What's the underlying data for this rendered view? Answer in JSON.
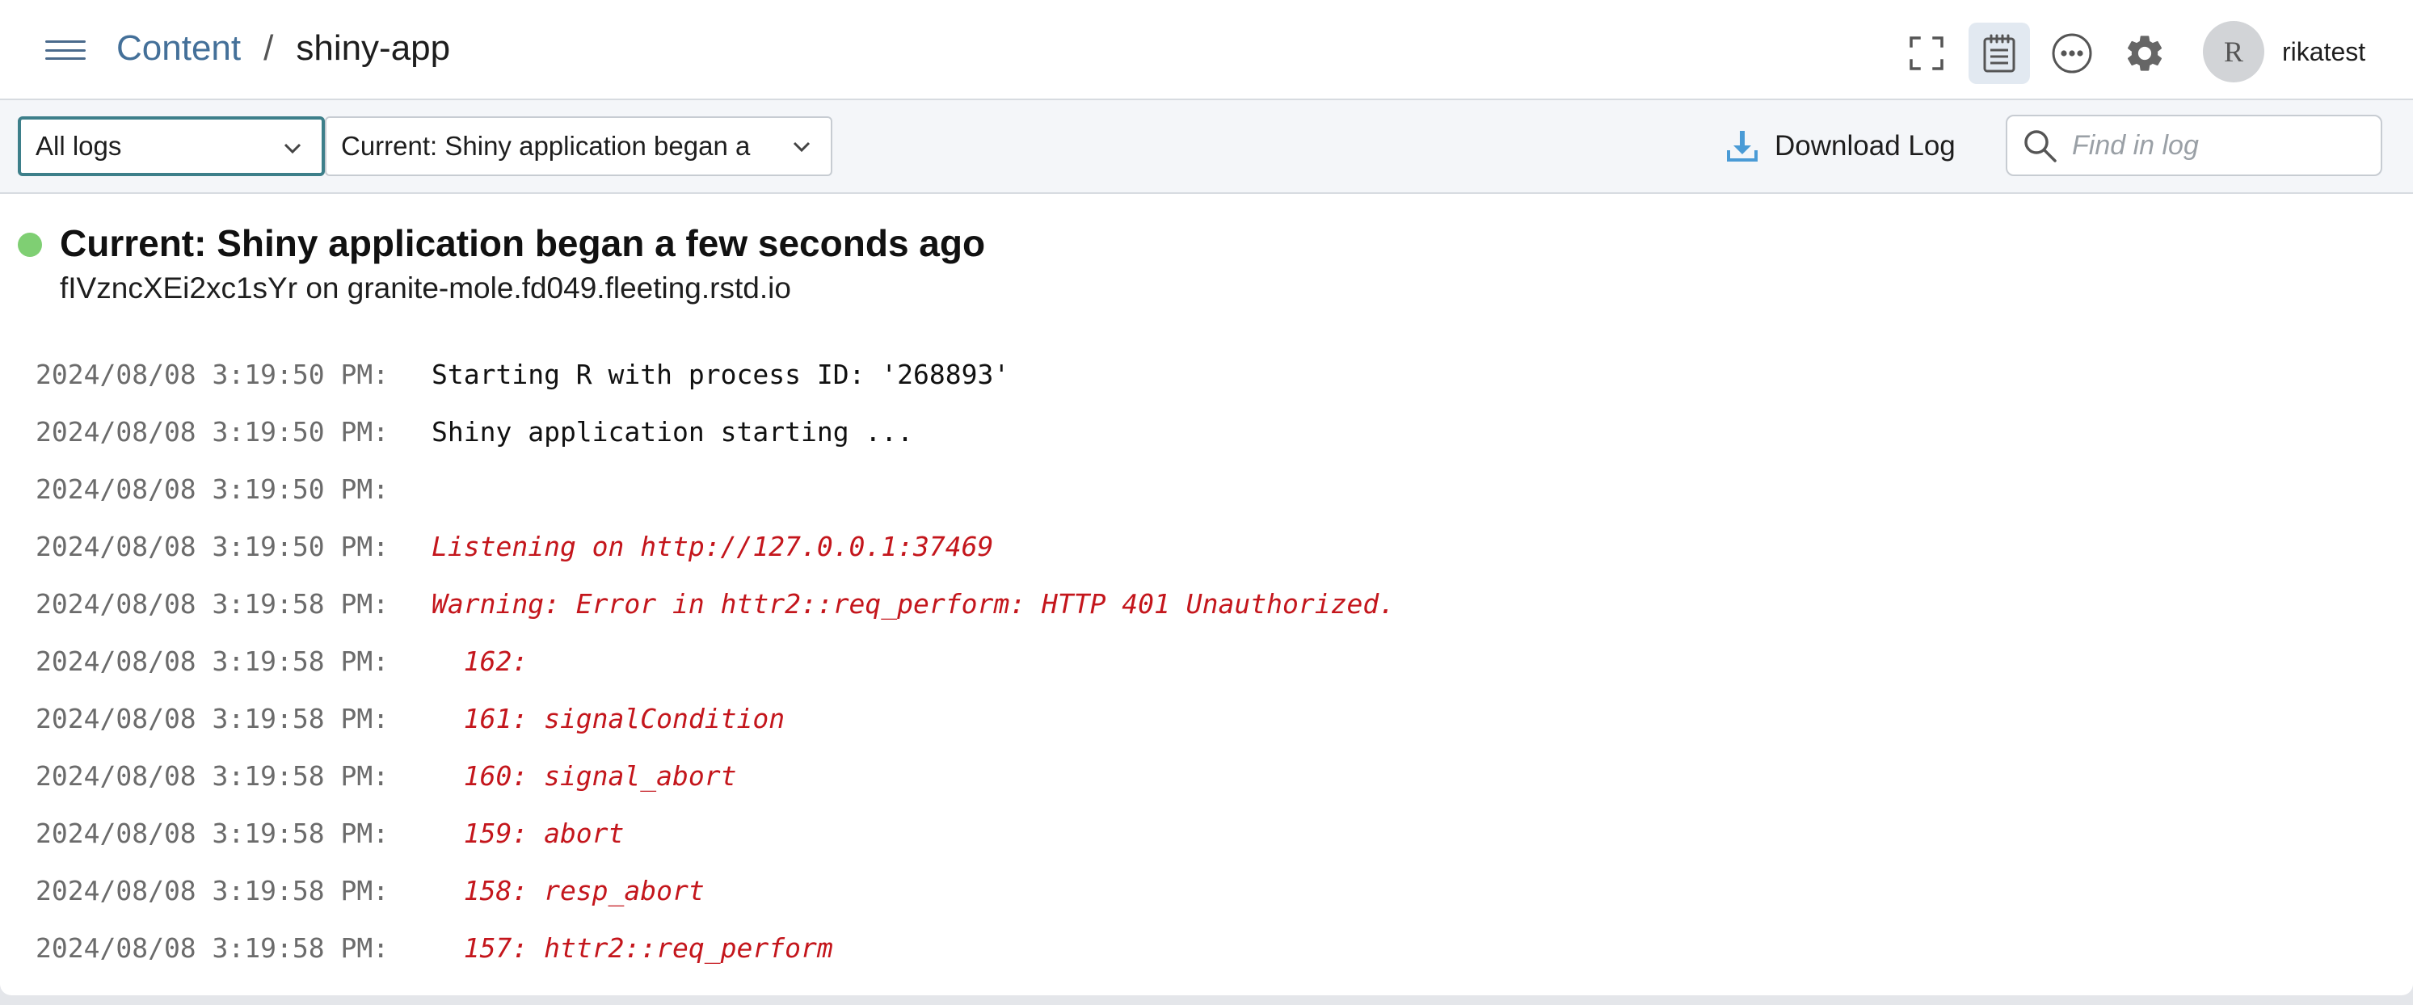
{
  "breadcrumb": {
    "root": "Content",
    "separator": "/",
    "current": "shiny-app"
  },
  "toolbar": {
    "icons": [
      "fullscreen-icon",
      "logs-icon",
      "more-options-icon",
      "settings-icon"
    ],
    "active_icon": "logs-icon"
  },
  "user": {
    "initial": "R",
    "name": "rikatest"
  },
  "filters": {
    "log_filter": "All logs",
    "job_filter": "Current: Shiny application began a"
  },
  "download_label": "Download Log",
  "search": {
    "placeholder": "Find in log",
    "value": ""
  },
  "job": {
    "title": "Current: Shiny application began a few seconds ago",
    "subtitle": "fIVzncXEi2xc1sYr on granite-mole.fd049.fleeting.rstd.io",
    "status_color": "#7fcf73"
  },
  "colors": {
    "accent": "#447099",
    "error": "#c4161c",
    "focus": "#3d7f8a"
  },
  "logs": [
    {
      "timestamp": "2024/08/08 3:19:50 PM:",
      "message": "Starting R with process ID: '268893'",
      "level": "stdout"
    },
    {
      "timestamp": "2024/08/08 3:19:50 PM:",
      "message": "Shiny application starting ...",
      "level": "stdout"
    },
    {
      "timestamp": "2024/08/08 3:19:50 PM:",
      "message": "",
      "level": "stdout"
    },
    {
      "timestamp": "2024/08/08 3:19:50 PM:",
      "message": "Listening on http://127.0.0.1:37469",
      "level": "stderr"
    },
    {
      "timestamp": "2024/08/08 3:19:58 PM:",
      "message": "Warning: Error in httr2::req_perform: HTTP 401 Unauthorized.",
      "level": "stderr"
    },
    {
      "timestamp": "2024/08/08 3:19:58 PM:",
      "message": "  162: ",
      "level": "stderr"
    },
    {
      "timestamp": "2024/08/08 3:19:58 PM:",
      "message": "  161: signalCondition",
      "level": "stderr"
    },
    {
      "timestamp": "2024/08/08 3:19:58 PM:",
      "message": "  160: signal_abort",
      "level": "stderr"
    },
    {
      "timestamp": "2024/08/08 3:19:58 PM:",
      "message": "  159: abort",
      "level": "stderr"
    },
    {
      "timestamp": "2024/08/08 3:19:58 PM:",
      "message": "  158: resp_abort",
      "level": "stderr"
    },
    {
      "timestamp": "2024/08/08 3:19:58 PM:",
      "message": "  157: httr2::req_perform",
      "level": "stderr"
    }
  ]
}
